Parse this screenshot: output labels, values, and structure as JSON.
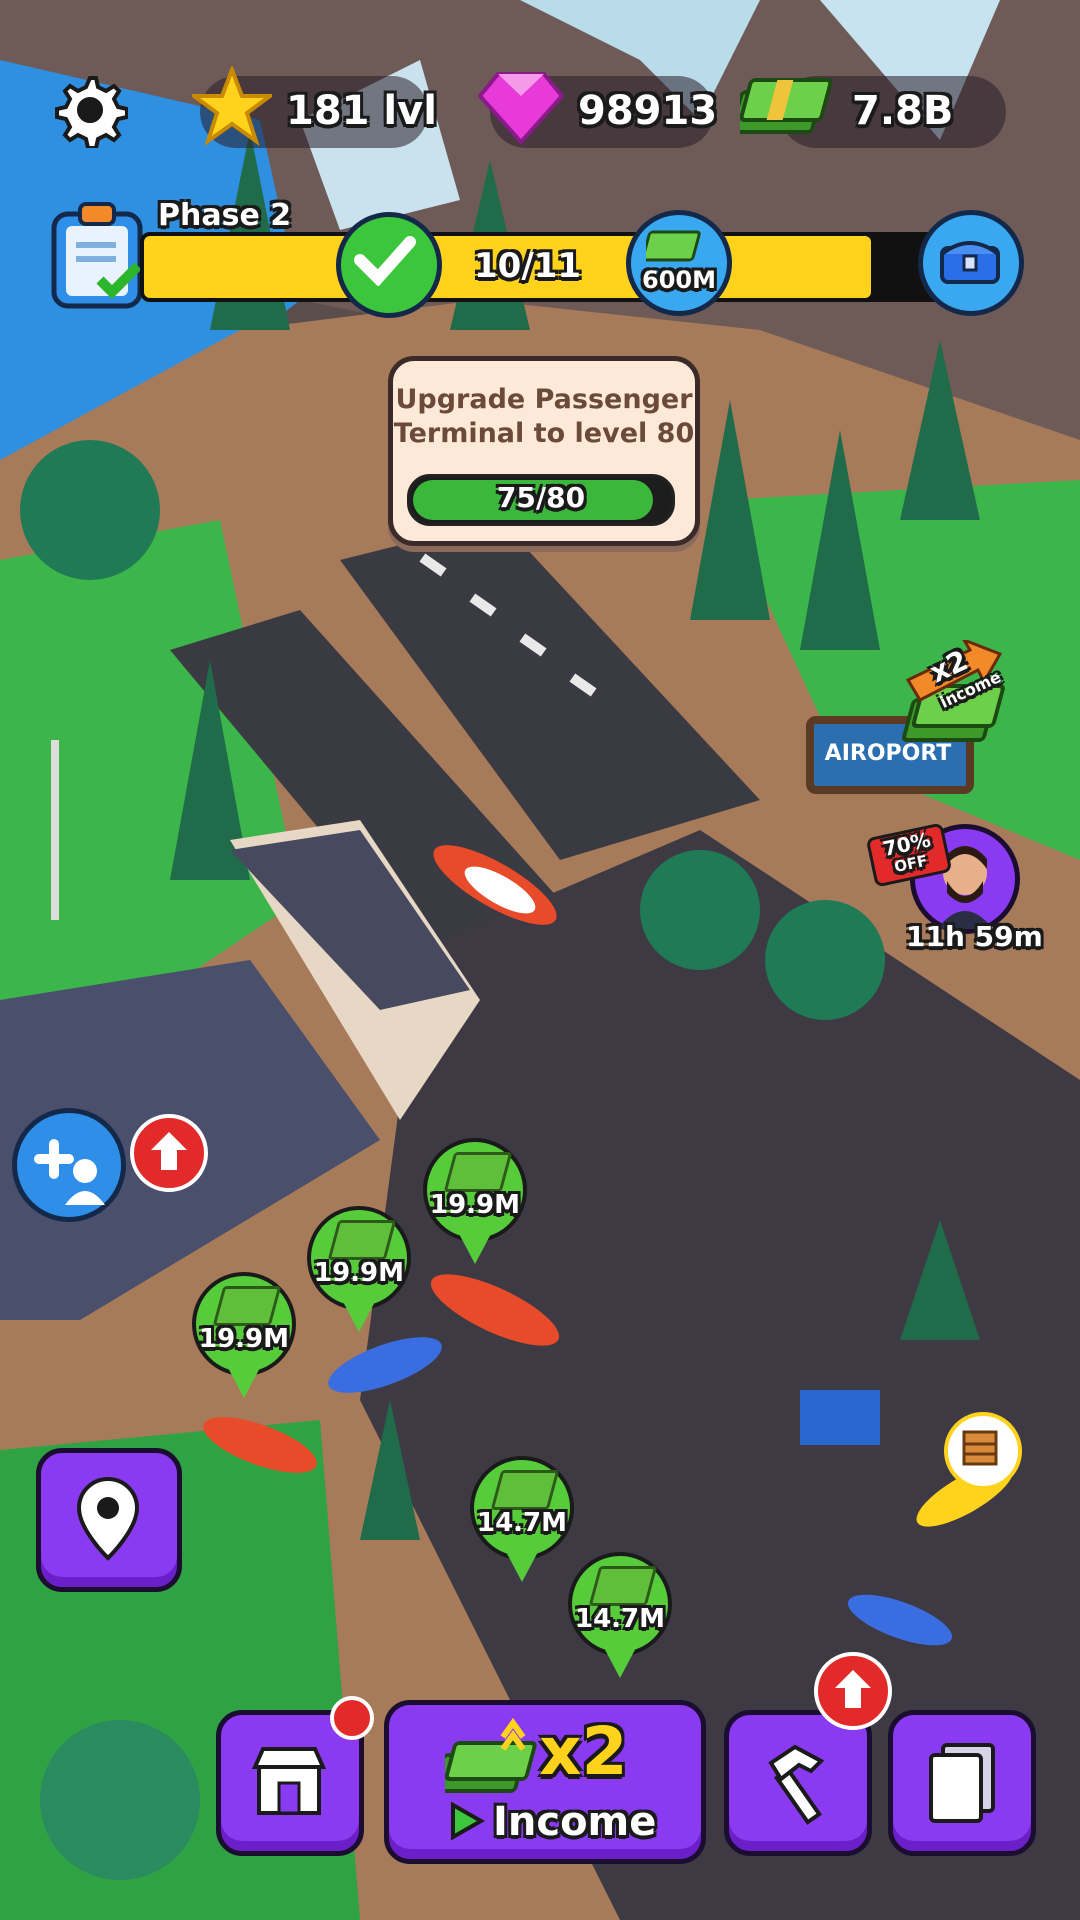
{
  "hud": {
    "settings_icon": "gear-icon",
    "level": {
      "icon": "star-icon",
      "value": "181 lvl"
    },
    "gems": {
      "icon": "gem-icon",
      "value": "98913"
    },
    "cash": {
      "icon": "cash-icon",
      "value": "7.8B"
    }
  },
  "phase": {
    "label": "Phase 2",
    "progress_text": "10/11",
    "progress_fraction": 0.909,
    "reward_value": "600M"
  },
  "task": {
    "title_line1": "Upgrade Passenger",
    "title_line2": "Terminal to level 80",
    "progress_text": "75/80",
    "progress_fraction": 0.9375
  },
  "offers": {
    "income_boost_label": "x2",
    "income_boost_sub": "income",
    "sign_text": "AIROPORT",
    "discount_line1": "70%",
    "discount_line2": "OFF",
    "timer": "11h 59m"
  },
  "income_pins": [
    {
      "value": "19.9M"
    },
    {
      "value": "19.9M"
    },
    {
      "value": "19.9M"
    },
    {
      "value": "14.7M"
    },
    {
      "value": "14.7M"
    }
  ],
  "bottom_bar": {
    "shop_icon": "shop-icon",
    "income_multiplier": "x2",
    "income_label": "Income",
    "build_icon": "hammer-icon",
    "cards_icon": "cards-icon"
  },
  "colors": {
    "accent_purple": "#8a3af0",
    "progress_yellow": "#ffd21c",
    "pin_green": "#56cc3a",
    "alert_red": "#e32a2a"
  }
}
